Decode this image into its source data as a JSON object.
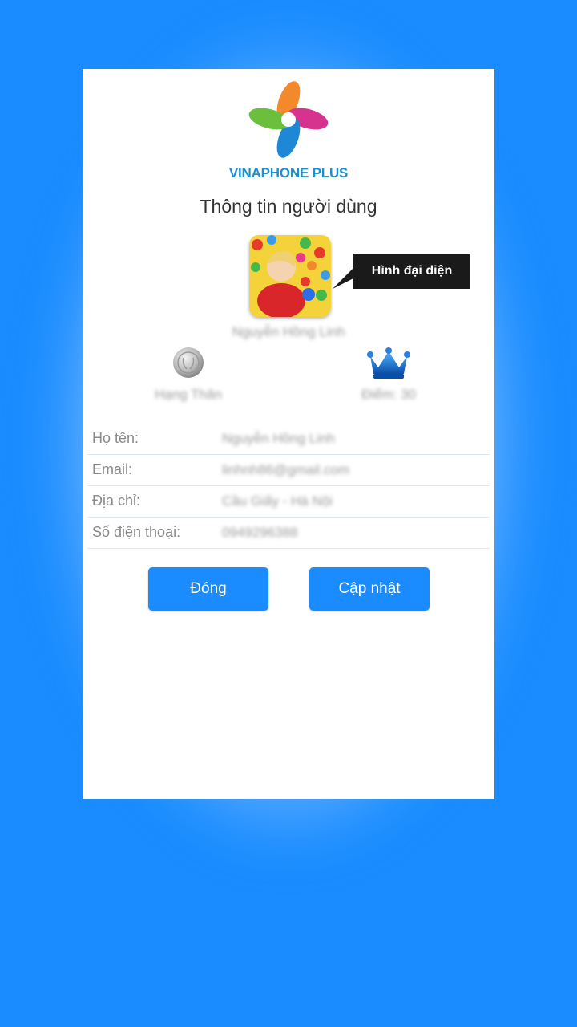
{
  "brand": {
    "name": "VINAPHONE PLUS",
    "color": "#1b8fd1"
  },
  "page": {
    "title": "Thông tin người dùng"
  },
  "profile": {
    "avatar_tooltip": "Hình đại diện",
    "username": "Nguyễn Hồng Linh",
    "rank": "Hạng Thân",
    "points": "Điểm: 30",
    "rank_icon": "silver-medal-icon",
    "points_icon": "crown-icon"
  },
  "info": [
    {
      "label": "Họ tên:",
      "value": "Nguyễn Hồng Linh"
    },
    {
      "label": "Email:",
      "value": "linhnh86@gmail.com"
    },
    {
      "label": "Địa chỉ:",
      "value": "Cầu Giấy - Hà Nội"
    },
    {
      "label": "Số điện thoại:",
      "value": "0949296388"
    }
  ],
  "buttons": {
    "close": "Đóng",
    "update": "Cập nhật"
  },
  "colors": {
    "background": "#1a8cff",
    "button": "#1a8cff",
    "accent": "#1b8fd1"
  }
}
